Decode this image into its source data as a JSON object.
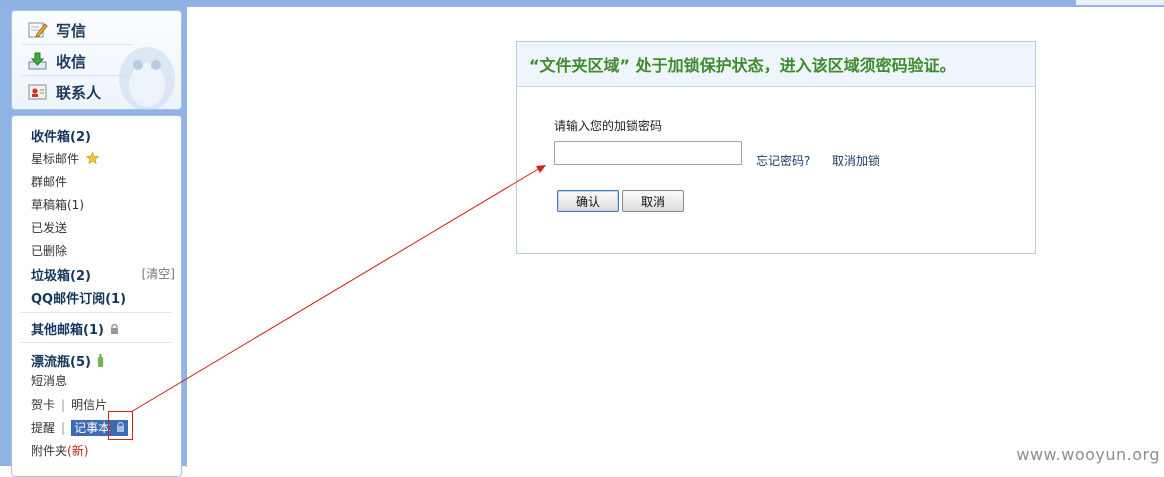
{
  "compose": {
    "write": "写信",
    "receive": "收信",
    "contacts": "联系人"
  },
  "folders": {
    "inbox": "收件箱(2)",
    "starred": "星标邮件",
    "group": "群邮件",
    "drafts": "草稿箱(1)",
    "sent": "已发送",
    "deleted": "已删除",
    "spam": "垃圾箱(2)",
    "spam_clear": "[清空]",
    "qq_subscribe": "QQ邮件订阅(1)",
    "other_mailbox": "其他邮箱(1)",
    "drift_bottle": "漂流瓶(5)",
    "short_message": "短消息",
    "greeting_card": "贺卡",
    "postcard": "明信片",
    "reminder": "提醒",
    "notebook": "记事本",
    "attachments": "附件夹",
    "attachments_new": "(新)"
  },
  "dialog": {
    "title": "“文件夹区域” 处于加锁保护状态，进入该区域须密码验证。",
    "prompt": "请输入您的加锁密码",
    "password_value": "",
    "forgot": "忘记密码?",
    "unlock": "取消加锁",
    "confirm": "确认",
    "cancel": "取消"
  },
  "watermark": "www.wooyun.org",
  "colors": {
    "accent": "#8fb3e2",
    "title_green": "#3f8a2a",
    "highlight": "#3d6ab0",
    "annotation_red": "#d0231b"
  },
  "icons": [
    "pencil-paper-icon",
    "download-tray-icon",
    "contact-card-icon",
    "star-icon",
    "lock-icon",
    "bottle-icon",
    "qq-penguin-icon"
  ]
}
